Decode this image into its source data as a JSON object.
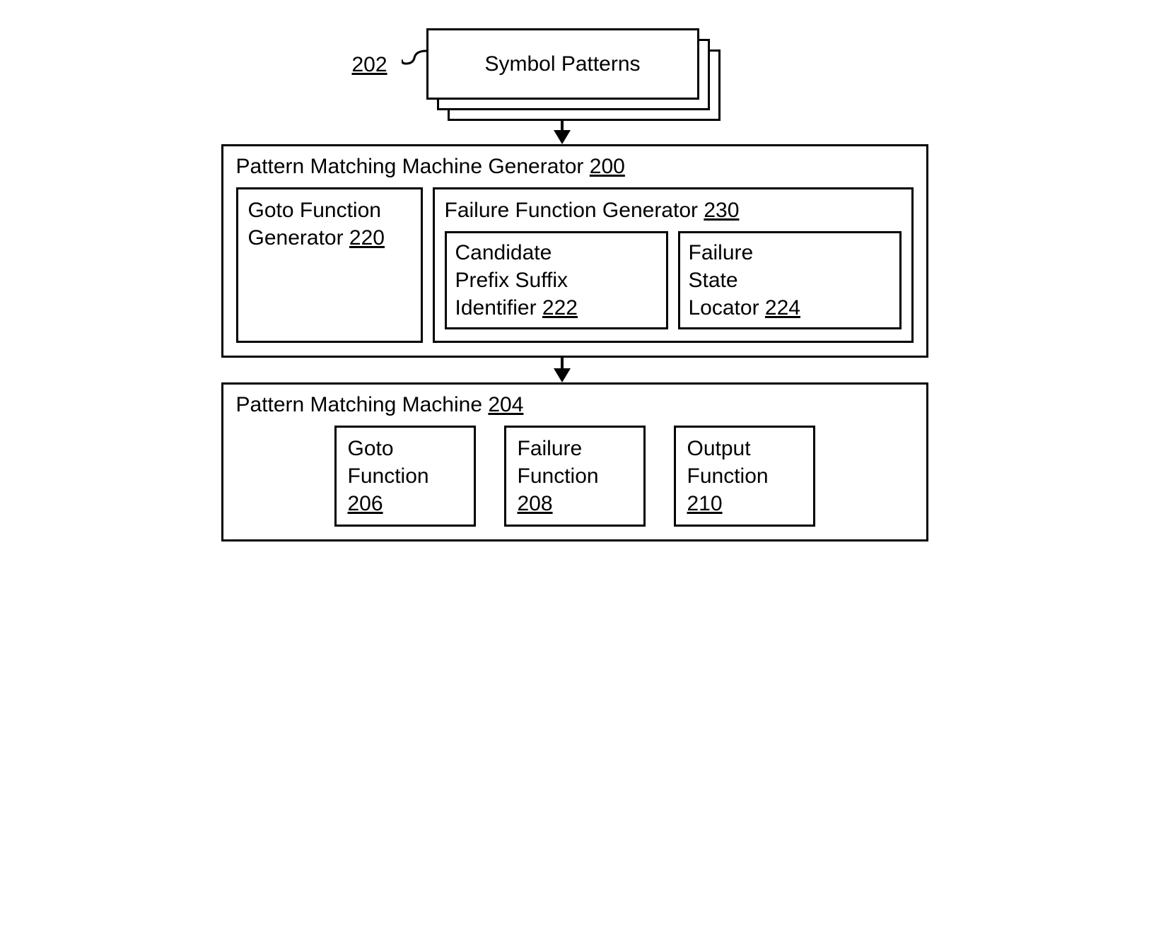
{
  "top": {
    "ref": "202",
    "label": "Symbol Patterns"
  },
  "generator": {
    "title_prefix": "Pattern Matching Machine Generator ",
    "title_ref": "200",
    "goto_gen": {
      "line1": "Goto Function",
      "line2_prefix": "Generator ",
      "line2_ref": "220"
    },
    "fail_gen": {
      "title_prefix": "Failure Function Generator ",
      "title_ref": "230",
      "candidate": {
        "l1": "Candidate",
        "l2": "Prefix Suffix",
        "l3_prefix": "Identifier ",
        "l3_ref": "222"
      },
      "locator": {
        "l1": "Failure",
        "l2": "State",
        "l3_prefix": "Locator ",
        "l3_ref": "224"
      }
    }
  },
  "machine": {
    "title_prefix": "Pattern Matching Machine ",
    "title_ref": "204",
    "goto": {
      "l1": "Goto",
      "l2": "Function",
      "ref": "206"
    },
    "failure": {
      "l1": "Failure",
      "l2": "Function",
      "ref": "208"
    },
    "output": {
      "l1": "Output",
      "l2": "Function",
      "ref": "210"
    }
  }
}
